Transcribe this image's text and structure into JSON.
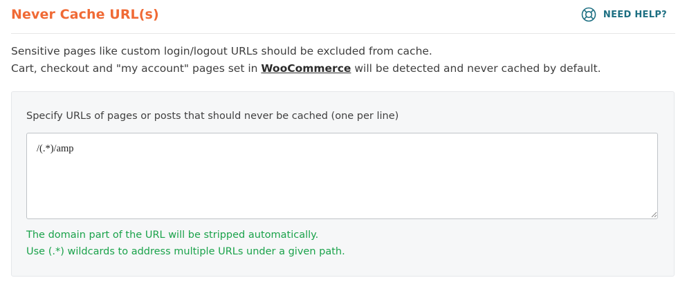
{
  "header": {
    "title": "Never Cache URL(s)",
    "help_label": "NEED HELP?",
    "help_icon": "lifebuoy-icon"
  },
  "intro": {
    "line1": "Sensitive pages like custom login/logout URLs should be excluded from cache.",
    "line2_before": "Cart, checkout and \"my account\" pages set in ",
    "line2_link": "WooCommerce",
    "line2_after": " will be detected and never cached by default."
  },
  "panel": {
    "field_label": "Specify URLs of pages or posts that should never be cached (one per line)",
    "field_value": "/(.*)/amp",
    "note1": "The domain part of the URL will be stripped automatically.",
    "note2": "Use (.*) wildcards to address multiple URLs under a given path."
  },
  "colors": {
    "title": "#f06a35",
    "help": "#1d6f82",
    "note": "#1aa24a"
  }
}
